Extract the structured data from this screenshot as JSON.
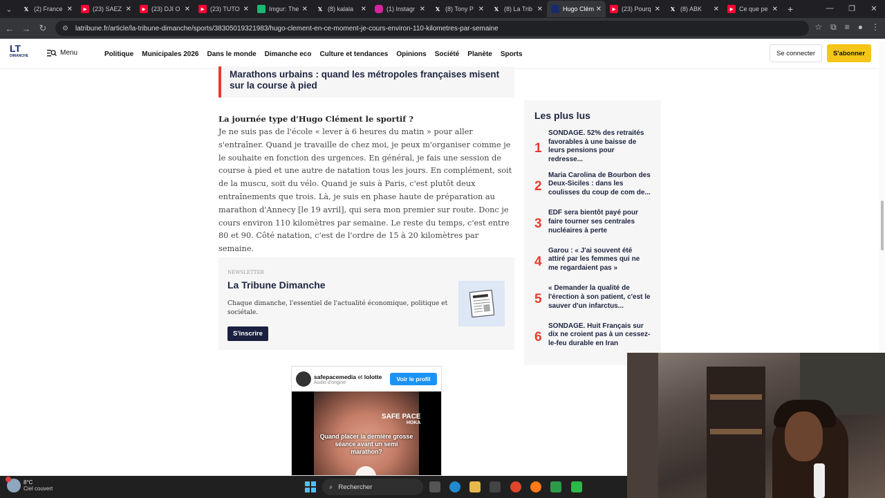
{
  "browser": {
    "tabs": [
      {
        "label": "(2) France",
        "favicon": "x",
        "color": "#000000"
      },
      {
        "label": "(23) SAEZ",
        "favicon": "youtube",
        "color": "#ff0033"
      },
      {
        "label": "(23) DJI O",
        "favicon": "youtube",
        "color": "#ff0033"
      },
      {
        "label": "(23) TUTO",
        "favicon": "youtube",
        "color": "#ff0033"
      },
      {
        "label": "Imgur: The",
        "favicon": "imgur",
        "color": "#1bb76e"
      },
      {
        "label": "(8) kalala",
        "favicon": "x",
        "color": "#000000"
      },
      {
        "label": "(1) Instagr",
        "favicon": "instagram",
        "color": "#d6249f"
      },
      {
        "label": "(8) Tony P",
        "favicon": "x",
        "color": "#000000"
      },
      {
        "label": "(8) La Trib",
        "favicon": "x",
        "color": "#000000"
      },
      {
        "label": "Hugo Clém",
        "favicon": "latribune",
        "color": "#1a2b6b",
        "active": true
      },
      {
        "label": "(23) Pourq",
        "favicon": "youtube",
        "color": "#ff0033"
      },
      {
        "label": "(8) ABK",
        "favicon": "x",
        "color": "#000000"
      },
      {
        "label": "Ce que pe",
        "favicon": "youtube",
        "color": "#ff0033"
      }
    ],
    "url": "latribune.fr/article/la-tribune-dimanche/sports/38305019321983/hugo-clement-en-ce-moment-je-cours-environ-110-kilometres-par-semaine"
  },
  "header": {
    "logo_text": "LT",
    "logo_sub": "DIMANCHE",
    "menu_label": "Menu",
    "nav": [
      "Politique",
      "Municipales 2026",
      "Dans le monde",
      "Dimanche eco",
      "Culture et tendances",
      "Opinions",
      "Société",
      "Planète",
      "Sports"
    ],
    "login_label": "Se connecter",
    "subscribe_label": "S'abonner"
  },
  "article": {
    "related_title": "Marathons urbains : quand les métropoles françaises misent sur la course à pied",
    "question": "La journée type d'Hugo Clément le sportif ?",
    "answer": "Je ne suis pas de l'école « lever à 6 heures du matin » pour aller s'entraîner. Quand je travaille de chez moi, je peux m'organiser comme je le souhaite en fonction des urgences. En général, je fais une session de course à pied et une autre de natation tous les jours. En complément, soit de la muscu, soit du vélo. Quand je suis à Paris, c'est plutôt deux entraînements que trois. Là, je suis en phase haute de préparation au marathon d'Annecy [le 19 avril], qui sera mon premier sur route. Donc je cours environ 110 kilomètres par semaine. Le reste du temps, c'est entre 80 et 90. Côté natation, c'est de l'ordre de 15 à 20 kilomètres par semaine."
  },
  "newsletter": {
    "kicker": "NEWSLETTER",
    "title": "La Tribune Dimanche",
    "description": "Chaque dimanche, l'essentiel de l'actualité économique, politique et sociétale.",
    "button": "S'inscrire"
  },
  "instagram": {
    "user1": "safepacemedia",
    "and": "et",
    "user2": "lolotte",
    "audio": "Audio d'origine",
    "follow": "Voir le profil",
    "brand": "SAFE PACE",
    "brand_sub": "HOKA",
    "caption": "Quand placer la dernière grosse séance avant un semi marathon?"
  },
  "most_read": {
    "title": "Les plus lus",
    "items": [
      {
        "num": "1",
        "text": "SONDAGE. 52% des retraités favorables à une baisse de leurs pensions pour redresse..."
      },
      {
        "num": "2",
        "text": "Maria Carolina de Bourbon des Deux-Siciles : dans les coulisses du coup de com de..."
      },
      {
        "num": "3",
        "text": "EDF sera bientôt payé pour faire tourner ses centrales nucléaires à perte"
      },
      {
        "num": "4",
        "text": "Garou : « J'ai souvent été attiré par les femmes qui ne me regardaient pas »"
      },
      {
        "num": "5",
        "text": "« Demander la qualité de l'érection à son patient, c'est le sauver d'un infarctus..."
      },
      {
        "num": "6",
        "text": "SONDAGE. Huit Français sur dix ne croient pas à un cessez-le-feu durable en Iran"
      }
    ]
  },
  "taskbar": {
    "temp": "8°C",
    "weather": "Ciel couvert",
    "search": "Rechercher"
  }
}
